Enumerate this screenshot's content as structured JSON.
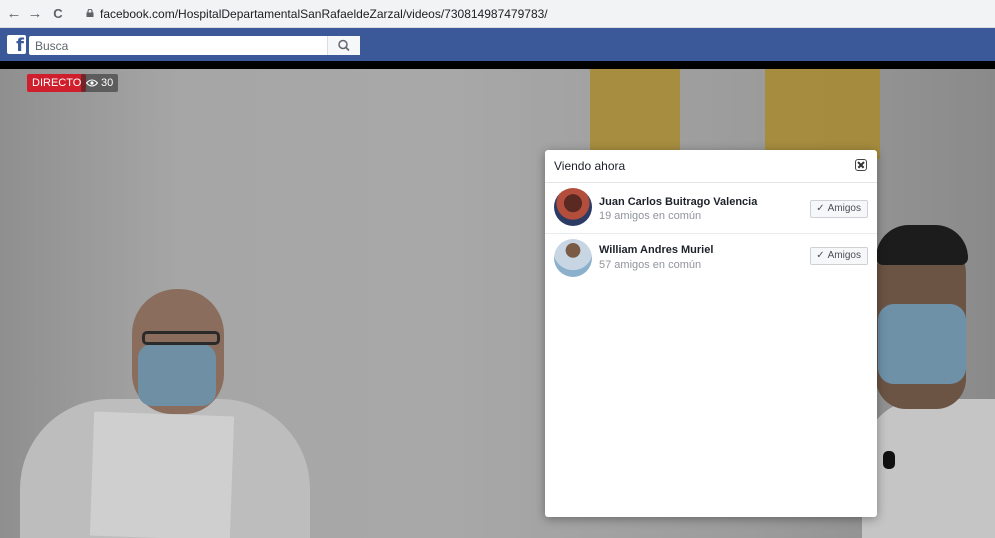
{
  "browser": {
    "back_glyph": "←",
    "forward_glyph": "→",
    "reload_glyph": "C",
    "url": "facebook.com/HospitalDepartamentalSanRafaeldeZarzal/videos/730814987479783/"
  },
  "facebook": {
    "logo": "f",
    "search_placeholder": "Busca"
  },
  "video": {
    "live_label": "DIRECTO",
    "viewer_count": "30"
  },
  "viewers_modal": {
    "title": "Viendo ahora",
    "viewers": [
      {
        "name": "Juan Carlos Buitrago Valencia",
        "mutual": "19 amigos en común",
        "button": "Amigos"
      },
      {
        "name": "William Andres Muriel",
        "mutual": "57 amigos en común",
        "button": "Amigos"
      }
    ]
  },
  "colors": {
    "facebook_blue": "#3b5998",
    "live_red": "#d01f2c"
  }
}
